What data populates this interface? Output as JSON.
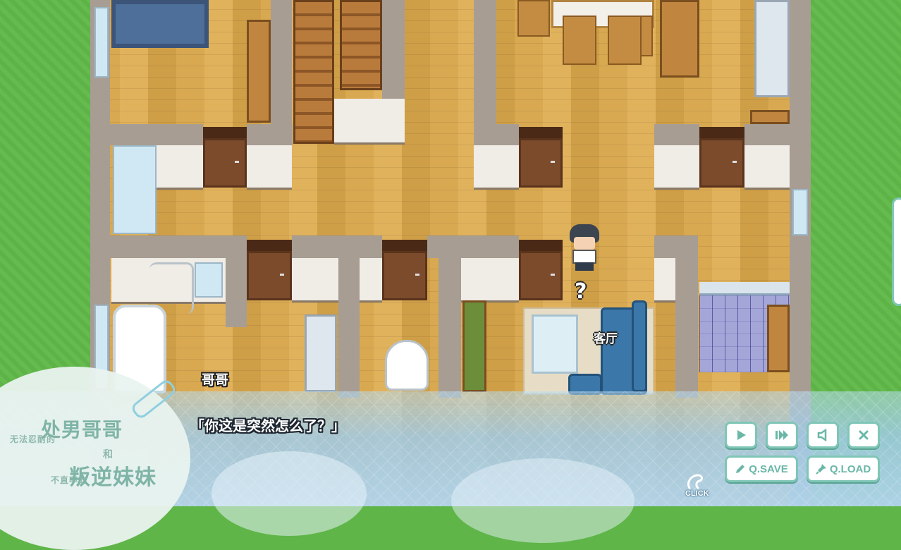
{
  "scene": {
    "map_label": "客厅",
    "emote": "?"
  },
  "dialog": {
    "speaker": "哥哥",
    "text": "「你这是突然怎么了？」"
  },
  "logo": {
    "line1": "无法忍耐的",
    "line2": "处男哥哥",
    "line3": "和",
    "line4": "不直率的",
    "line5": "叛逆妹妹"
  },
  "controls": {
    "auto_icon": "play-icon",
    "skip_icon": "fast-forward-icon",
    "voice_icon": "speaker-icon",
    "close_icon": "close-icon",
    "save_label": "Q.SAVE",
    "load_label": "Q.LOAD",
    "click_label": "CLICK"
  },
  "colors": {
    "accent": "#7fc6b7",
    "dialog_bg": "#a8cfe8",
    "grass": "#5fb548",
    "floor": "#d9a952"
  }
}
